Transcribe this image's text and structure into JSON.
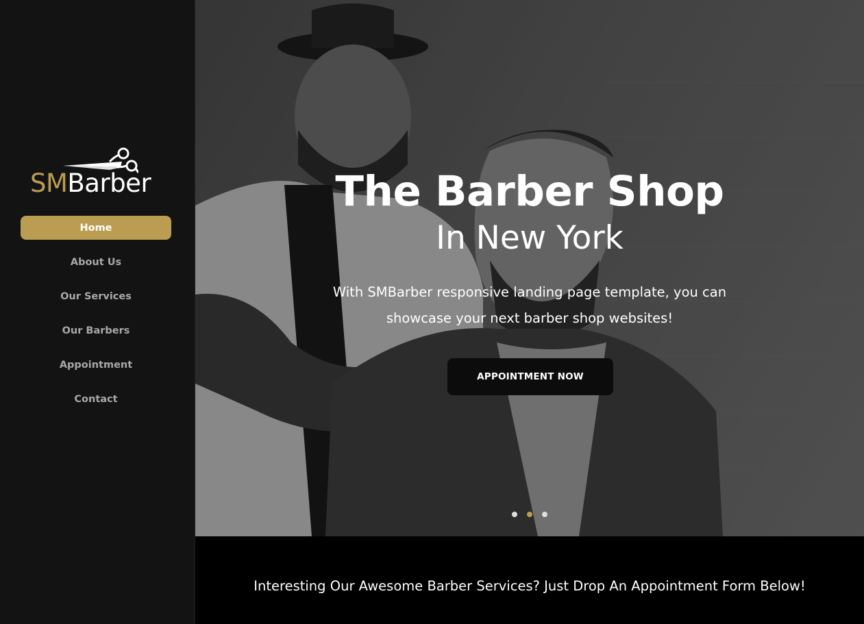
{
  "brand": {
    "logo_part1": "SM",
    "logo_part2": "Barber",
    "accent_color": "#bb9d51",
    "icon": "scissors-icon"
  },
  "nav": {
    "items": [
      {
        "label": "Home",
        "active": true
      },
      {
        "label": "About Us",
        "active": false
      },
      {
        "label": "Our Services",
        "active": false
      },
      {
        "label": "Our Barbers",
        "active": false
      },
      {
        "label": "Appointment",
        "active": false
      },
      {
        "label": "Contact",
        "active": false
      }
    ]
  },
  "hero": {
    "title": "The Barber Shop",
    "subtitle": "In New York",
    "description": "With SMBarber responsive landing page template, you can showcase your next barber shop websites!",
    "button_label": "APPOINTMENT NOW",
    "slides": 3,
    "active_slide": 2
  },
  "banner": {
    "text": "Interesting Our Awesome Barber Services? Just Drop An Appointment Form Below!"
  }
}
